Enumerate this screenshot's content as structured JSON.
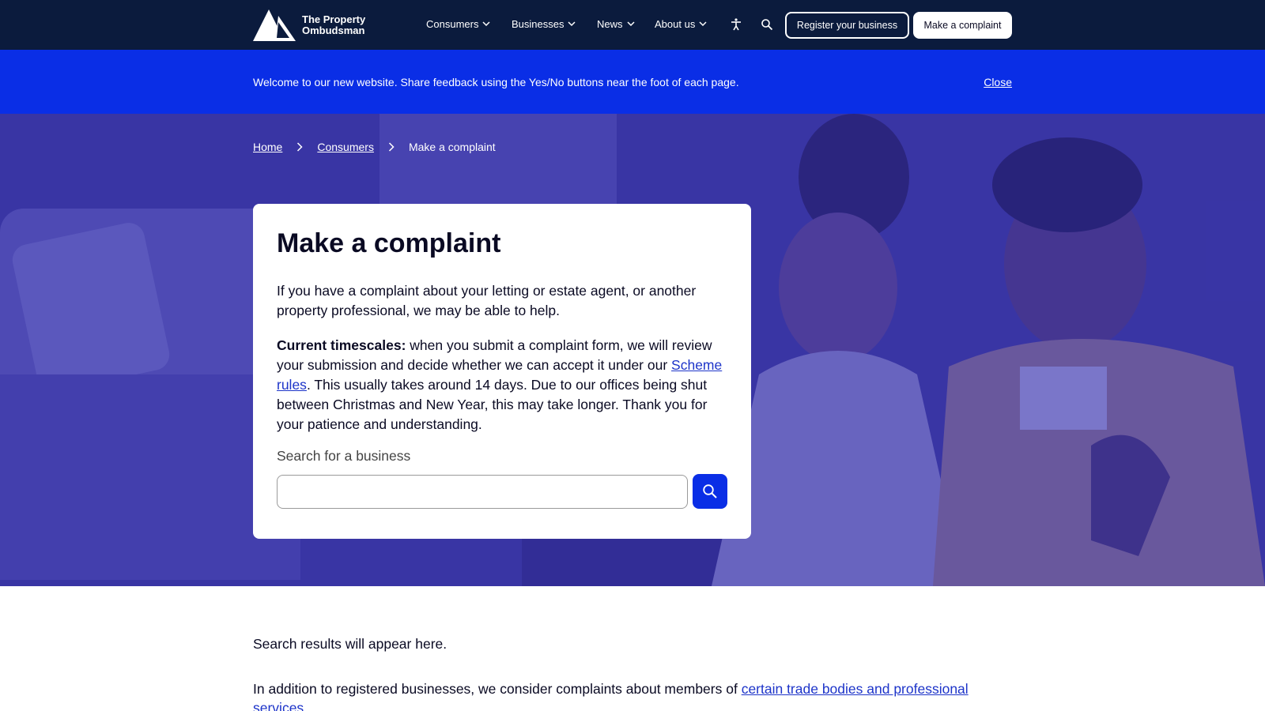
{
  "header": {
    "logo_line1": "The Property",
    "logo_line2": "Ombudsman",
    "nav": [
      {
        "label": "Consumers"
      },
      {
        "label": "Businesses"
      },
      {
        "label": "News"
      },
      {
        "label": "About us"
      }
    ],
    "register_label": "Register your business",
    "complaint_label": "Make a complaint"
  },
  "banner": {
    "text": "Welcome to our new website. Share feedback using the Yes/No buttons near the foot of each page.",
    "close_label": "Close"
  },
  "breadcrumb": {
    "home": "Home",
    "consumers": "Consumers",
    "current": "Make a complaint"
  },
  "card": {
    "title": "Make a complaint",
    "intro": "If you have a complaint about your letting or estate agent, or another property professional, we may be able to help.",
    "timescales_label": "Current timescales:",
    "timescales_text_1": " when you submit a complaint form, we will review your submission and decide whether we can accept it under our ",
    "scheme_rules_link": "Scheme rules",
    "timescales_text_2": ".  This usually takes around 14 days. Due to our offices being shut between Christmas and New Year, this may take longer. Thank you for your patience and understanding.",
    "search_label": "Search for a business",
    "search_value": ""
  },
  "results_text": "Search results will appear here.",
  "more": {
    "text": "In addition to registered businesses, we consider complaints about members of ",
    "link": "certain trade bodies and professional services",
    "end": "."
  },
  "colors": {
    "header_bg": "#0b1b3d",
    "banner_bg": "#0a2ee6",
    "accent": "#0a2ee6",
    "link": "#1d34c9"
  },
  "icons": [
    "logo-triangle-icon",
    "chevron-down-icon",
    "accessibility-icon",
    "search-icon",
    "chevron-right-icon"
  ]
}
